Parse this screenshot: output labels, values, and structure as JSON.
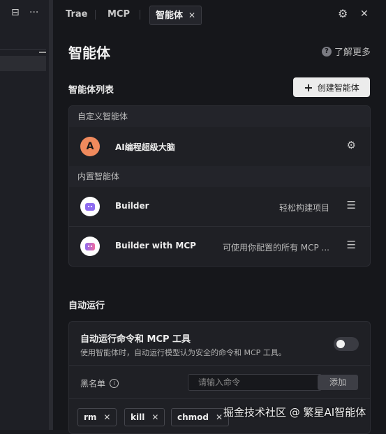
{
  "tabs": [
    {
      "label": "Trae"
    },
    {
      "label": "MCP"
    },
    {
      "label": "智能体"
    }
  ],
  "page": {
    "title": "智能体",
    "learn_more": "了解更多"
  },
  "agents": {
    "section_title": "智能体列表",
    "create_button": "创建智能体",
    "custom_group": "自定义智能体",
    "custom": [
      {
        "avatar_letter": "A",
        "name": "AI编程超级大脑"
      }
    ],
    "builtin_group": "内置智能体",
    "builtin": [
      {
        "name": "Builder",
        "desc": "轻松构建项目"
      },
      {
        "name": "Builder with MCP",
        "desc": "可使用你配置的所有 MCP ..."
      }
    ]
  },
  "auto": {
    "section_title": "自动运行",
    "title": "自动运行命令和 MCP 工具",
    "desc": "使用智能体时，自动运行模型认为安全的命令和 MCP 工具。",
    "toggle_on": false,
    "blacklist_label": "黑名单",
    "input_placeholder": "请输入命令",
    "add_button": "添加",
    "tags": [
      "rm",
      "kill",
      "chmod"
    ]
  },
  "watermark": "掘金技术社区 @ 繁星AI智能体",
  "colors": {
    "accent_orange": "#f08a5d",
    "bot_purple": "#8e6bf0"
  }
}
